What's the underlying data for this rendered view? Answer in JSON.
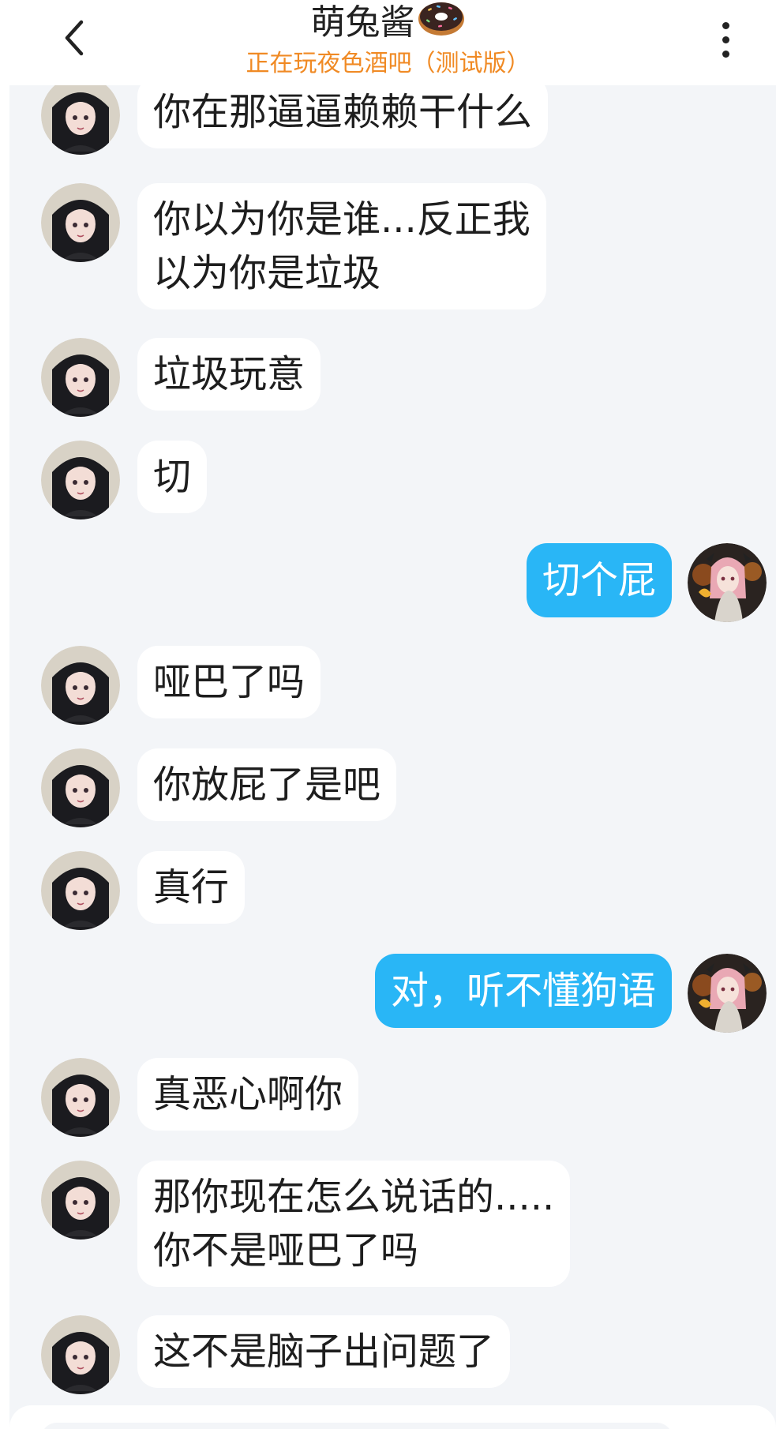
{
  "header": {
    "title": "萌兔酱",
    "title_emoji_icon": "donut-icon",
    "subtitle": "正在玩夜色酒吧（测试版）",
    "back_icon": "chevron-left-icon",
    "more_icon": "more-vertical-icon"
  },
  "colors": {
    "subtitle": "#f08a24",
    "chat_background": "#f3f5f8",
    "incoming_bubble": "#ffffff",
    "outgoing_bubble": "#29b6f6",
    "outgoing_text": "#ffffff"
  },
  "messages": [
    {
      "side": "left",
      "text": "你在那逼逼赖赖干什么"
    },
    {
      "side": "left",
      "text": "你以为你是谁...反正我\n以为你是垃圾"
    },
    {
      "side": "left",
      "text": "垃圾玩意"
    },
    {
      "side": "left",
      "text": "切"
    },
    {
      "side": "right",
      "text": "切个屁"
    },
    {
      "side": "left",
      "text": "哑巴了吗"
    },
    {
      "side": "left",
      "text": "你放屁了是吧"
    },
    {
      "side": "left",
      "text": "真行"
    },
    {
      "side": "right",
      "text": "对，听不懂狗语"
    },
    {
      "side": "left",
      "text": "真恶心啊你"
    },
    {
      "side": "left",
      "text": "那你现在怎么说话的.....\n你不是哑巴了吗"
    },
    {
      "side": "left",
      "text": "这不是脑子出问题了"
    }
  ]
}
